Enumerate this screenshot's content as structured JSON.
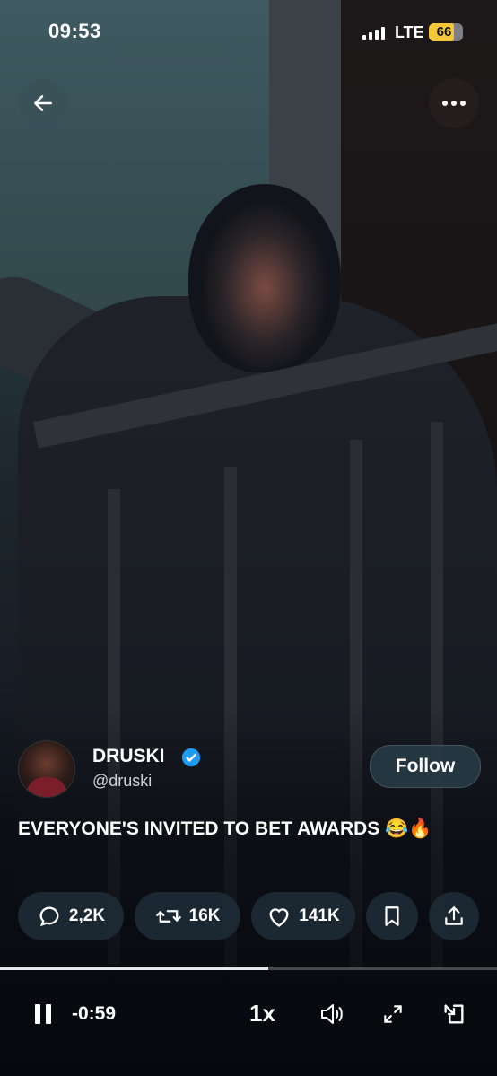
{
  "status_bar": {
    "time": "09:53",
    "network": "LTE",
    "battery": "66"
  },
  "top": {
    "back_icon": "arrow-left-icon",
    "more_icon": "more-horizontal-icon"
  },
  "post": {
    "author_name": "DRUSKI",
    "author_handle": "@druski",
    "follow_label": "Follow",
    "caption": "EVERYONE'S INVITED TO BET AWARDS 😂🔥"
  },
  "actions": {
    "replies": "2,2K",
    "reposts": "16K",
    "likes": "141K"
  },
  "player": {
    "remaining": "-0:59",
    "speed": "1x",
    "progress": 0.54
  },
  "colors": {
    "verified": "#1d9bf0",
    "battery": "#f3c73a"
  }
}
